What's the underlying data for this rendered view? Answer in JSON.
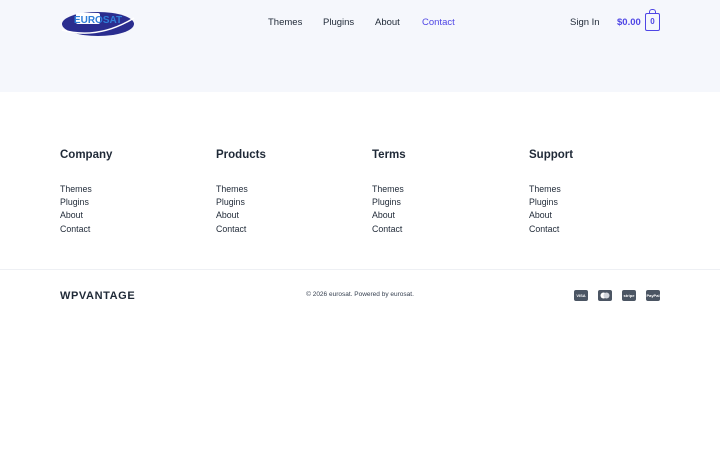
{
  "header": {
    "logo_text": "EUROSAT",
    "nav": [
      "Themes",
      "Plugins",
      "About",
      "Contact"
    ],
    "active_nav": "Contact",
    "sign_in": "Sign In",
    "cart_total": "$0.00",
    "cart_count": "0"
  },
  "footer": {
    "columns": [
      {
        "title": "Company",
        "links": [
          "Themes",
          "Plugins",
          "About",
          "Contact"
        ]
      },
      {
        "title": "Products",
        "links": [
          "Themes",
          "Plugins",
          "About",
          "Contact"
        ]
      },
      {
        "title": "Terms",
        "links": [
          "Themes",
          "Plugins",
          "About",
          "Contact"
        ]
      },
      {
        "title": "Support",
        "links": [
          "Themes",
          "Plugins",
          "About",
          "Contact"
        ]
      }
    ],
    "brand": "WPVANTAGE",
    "copyright": "© 2026 eurosat. Powered by eurosat.",
    "payment_icons": [
      {
        "icon": "visa-icon",
        "label": "VISA"
      },
      {
        "icon": "mastercard-icon",
        "label": ""
      },
      {
        "icon": "stripe-icon",
        "label": "stripe"
      },
      {
        "icon": "paypal-icon",
        "label": "PayPal"
      }
    ]
  },
  "colors": {
    "accent": "#4f46e5",
    "header_bg": "#f5f7fc",
    "logo_blue": "#2a2d8f"
  }
}
